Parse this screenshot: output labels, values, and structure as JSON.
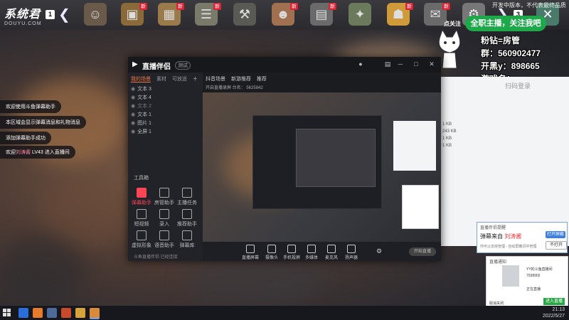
{
  "game_bar": {
    "logo_main": "系统君",
    "logo_sub": "DOUYU.COM",
    "left_badge": "1",
    "right_badge": "3",
    "new_tag": "新",
    "top_note": "开发中版本，不代表最终品质"
  },
  "overlay": {
    "bubble": "全职主播，关注我吧",
    "follow_tag": "点关注",
    "line1": "粉钻=房管",
    "line2": "群：560902477",
    "line3": "开黑y：898665",
    "line4": "游戏名："
  },
  "chat": [
    {
      "text": "欢迎使用斗鱼弹幕助手"
    },
    {
      "text": "本区域会显示弹幕消息和礼物消息"
    },
    {
      "text": "添加弹幕助手成功"
    },
    {
      "prefix": "欢迎",
      "highlight": "刘涛酱",
      "rest": "LV43 进入直播间"
    }
  ],
  "app": {
    "title": "直播伴侣",
    "tag": "测试",
    "controls": [
      "─",
      "□",
      "✕"
    ],
    "left_tabs": [
      "我的场景",
      "素材",
      "可放送"
    ],
    "layers": [
      "文本 3",
      "文本 4",
      "文本 2",
      "文本 1",
      "图片 1",
      "全屏 1"
    ],
    "tools_title": "工具箱",
    "tools": [
      {
        "label": "弹幕助手",
        "active": true
      },
      {
        "label": "房管助手",
        "active": false
      },
      {
        "label": "主播任务",
        "active": false
      },
      {
        "label": "短视频",
        "active": false
      },
      {
        "label": "录入",
        "active": false
      },
      {
        "label": "推荐助手",
        "active": false
      },
      {
        "label": "虚拟形象",
        "active": false
      },
      {
        "label": "语音助手",
        "active": false
      },
      {
        "label": "弹幕库",
        "active": false
      }
    ],
    "left_footer": "斗鱼直播伴侣 已经连接",
    "right_tabs": [
      "抖音场景",
      "新游推荐",
      "推荐"
    ],
    "source_info": "开启直播录屏  台名：",
    "source_id": "5625842",
    "bottom_buttons": [
      "直播屏幕",
      "摄像头",
      "手机投屏",
      "多媒体",
      "麦克风",
      "扬声器"
    ],
    "start_button": "开始直播"
  },
  "white_window": {
    "title": "扫码登录",
    "rows": [
      "1 KB",
      "243 KB",
      "1 KB",
      "1 KB"
    ]
  },
  "popup1": {
    "title": "直播伴侣提醒",
    "body": "弹幕来自",
    "user": "刘涛酱",
    "sub": "你可以去房管理 - 自动屏蔽词中管理",
    "btn1": "打开屏蔽",
    "btn2": "不打开"
  },
  "popup2": {
    "title": "直播通知",
    "name": "YY的斗鱼直播间",
    "id": "7038902",
    "status": "正在直播",
    "footer_left": "取消关闭",
    "footer_right": "进入直播"
  },
  "taskbar": {
    "time": "21:13",
    "date": "2022/5/27"
  }
}
